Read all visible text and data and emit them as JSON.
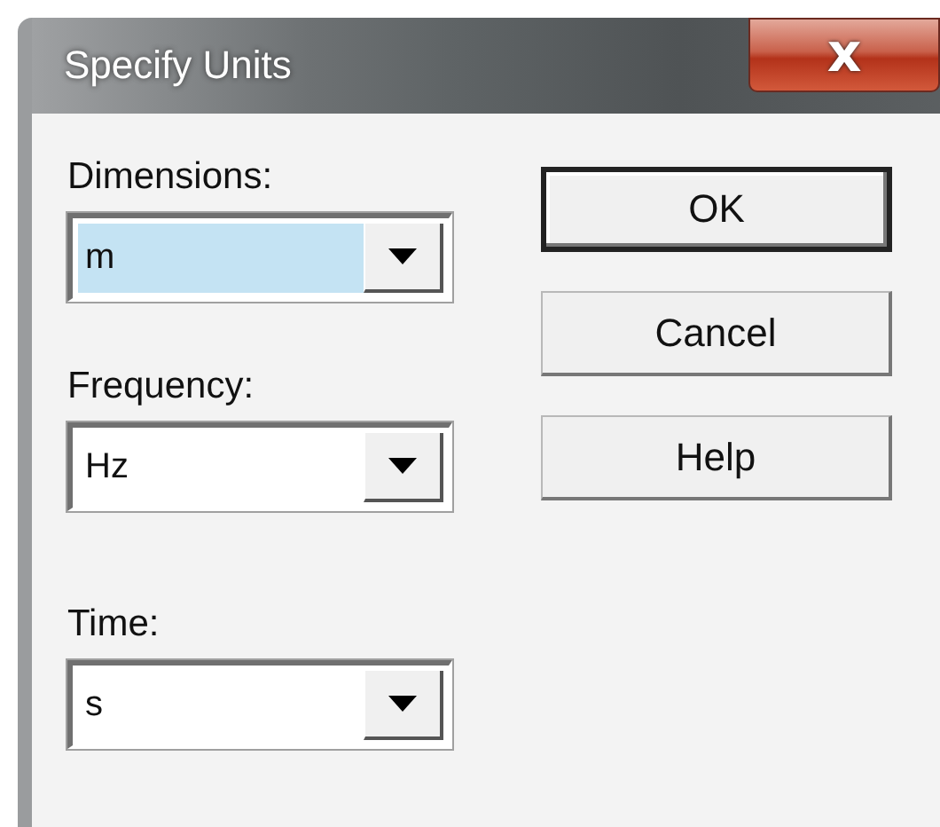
{
  "window": {
    "title": "Specify Units",
    "close_label": "x"
  },
  "fields": [
    {
      "label": "Dimensions:",
      "value": "m",
      "focused": true
    },
    {
      "label": "Frequency:",
      "value": "Hz",
      "focused": false
    },
    {
      "label": "Time:",
      "value": "s",
      "focused": false
    }
  ],
  "buttons": [
    {
      "label": "OK",
      "default": true
    },
    {
      "label": "Cancel",
      "default": false
    },
    {
      "label": "Help",
      "default": false
    }
  ]
}
